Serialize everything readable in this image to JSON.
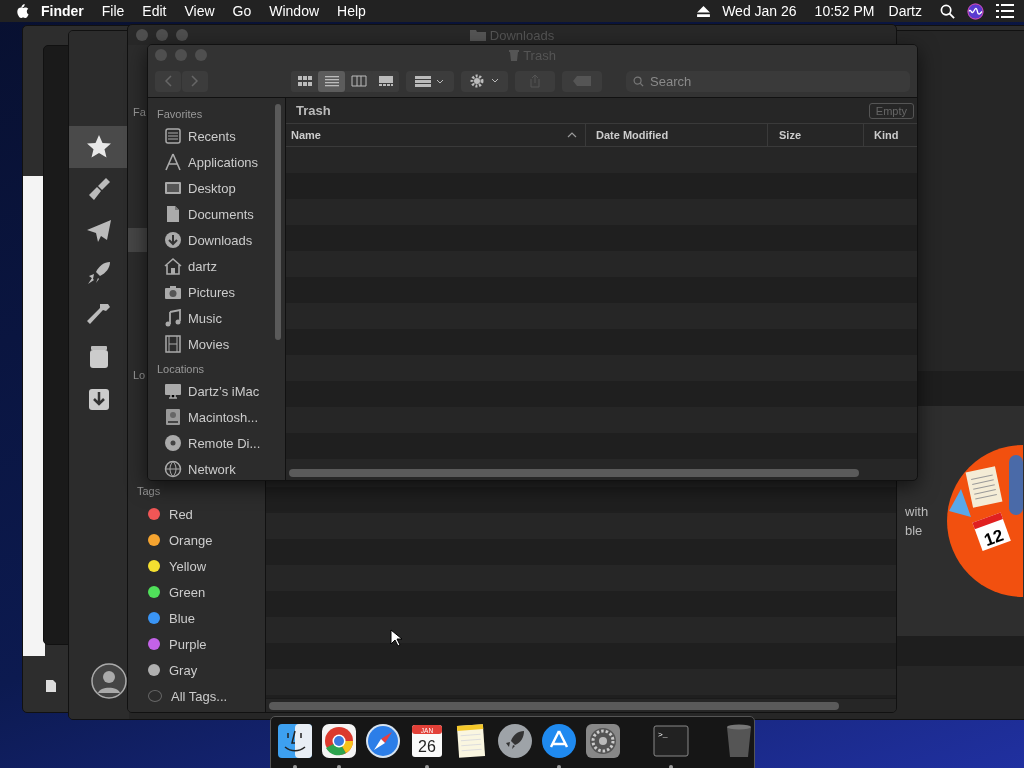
{
  "menu_bar": {
    "app_name": "Finder",
    "menus": [
      "File",
      "Edit",
      "View",
      "Go",
      "Window",
      "Help"
    ],
    "date": "Wed Jan 26",
    "time": "10:52 PM",
    "user": "Dartz"
  },
  "back_app_window": {
    "sidebar_icons": [
      {
        "kind": "star",
        "selected": true
      },
      {
        "kind": "brush",
        "selected": false
      },
      {
        "kind": "plane",
        "selected": false
      },
      {
        "kind": "rocket",
        "selected": false
      },
      {
        "kind": "hammer",
        "selected": false
      },
      {
        "kind": "jar",
        "selected": false
      },
      {
        "kind": "download",
        "selected": false
      }
    ],
    "text_lines": [
      "with",
      "ble"
    ],
    "illustration_day": "12"
  },
  "downloads_window": {
    "title": "Downloads",
    "sidebar_fragments": [
      "Fa",
      "Lo"
    ],
    "tags_heading": "Tags",
    "tags": [
      {
        "label": "Red",
        "color": "#f05656"
      },
      {
        "label": "Orange",
        "color": "#f5a430"
      },
      {
        "label": "Yellow",
        "color": "#f5e030"
      },
      {
        "label": "Green",
        "color": "#50e05a"
      },
      {
        "label": "Blue",
        "color": "#3a95f5"
      },
      {
        "label": "Purple",
        "color": "#c462e8"
      },
      {
        "label": "Gray",
        "color": "#b0b0b0"
      }
    ],
    "all_tags_label": "All Tags..."
  },
  "trash_window": {
    "title": "Trash",
    "view_buttons": [
      {
        "kind": "icons",
        "selected": false
      },
      {
        "kind": "list",
        "selected": true
      },
      {
        "kind": "columns",
        "selected": false
      },
      {
        "kind": "gallery",
        "selected": false
      }
    ],
    "search": {
      "placeholder": "Search"
    },
    "sidebar": [
      {
        "heading": "Favorites",
        "items": [
          {
            "label": "Recents",
            "kind": "recents"
          },
          {
            "label": "Applications",
            "kind": "applications"
          },
          {
            "label": "Desktop",
            "kind": "desktop"
          },
          {
            "label": "Documents",
            "kind": "documents"
          },
          {
            "label": "Downloads",
            "kind": "downloads"
          },
          {
            "label": "dartz",
            "kind": "home"
          },
          {
            "label": "Pictures",
            "kind": "camera"
          },
          {
            "label": "Music",
            "kind": "music"
          },
          {
            "label": "Movies",
            "kind": "film"
          }
        ]
      },
      {
        "heading": "Locations",
        "items": [
          {
            "label": "Dartz’s iMac",
            "kind": "monitor"
          },
          {
            "label": "Macintosh...",
            "kind": "disk"
          },
          {
            "label": "Remote Di...",
            "kind": "disc"
          },
          {
            "label": "Network",
            "kind": "network"
          }
        ]
      }
    ],
    "path_title": "Trash",
    "empty_button": "Empty",
    "columns": [
      {
        "label": "Name",
        "sorted": true
      },
      {
        "label": "Date Modified",
        "sorted": false
      },
      {
        "label": "Size",
        "sorted": false
      },
      {
        "label": "Kind",
        "sorted": false
      }
    ]
  },
  "dock": {
    "apps": [
      {
        "kind": "finder",
        "running": true
      },
      {
        "kind": "browser",
        "running": true
      },
      {
        "kind": "compass",
        "running": false
      },
      {
        "kind": "calendar",
        "running": true
      },
      {
        "kind": "notes",
        "running": false
      },
      {
        "kind": "rocket",
        "running": false
      },
      {
        "kind": "store",
        "running": true
      },
      {
        "kind": "settings",
        "running": false
      },
      {
        "kind": "terminal",
        "running": true
      },
      {
        "kind": "trash",
        "running": false
      }
    ],
    "calendar_month": "JAN",
    "calendar_day": "26",
    "terminal_prompt": ">_"
  }
}
